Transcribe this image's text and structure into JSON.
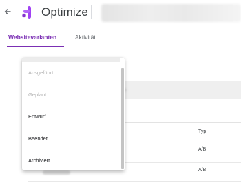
{
  "header": {
    "back_icon": "arrow-left-icon",
    "logo_icon": "optimize-logo-icon",
    "app_title": "Optimize",
    "accent_color": "#7b2fb4"
  },
  "tabs": [
    {
      "label": "Websitevarianten",
      "active": true
    },
    {
      "label": "Aktivität",
      "active": false
    }
  ],
  "table": {
    "columns": [
      "Typ"
    ],
    "rows": [
      {
        "type": "A/B"
      },
      {
        "type": "A/B"
      }
    ]
  },
  "status_menu": {
    "items": [
      {
        "label": "Ausgeführt",
        "enabled": false
      },
      {
        "label": "Geplant",
        "enabled": false
      },
      {
        "label": "Entwurf",
        "enabled": true
      },
      {
        "label": "Beendet",
        "enabled": true
      },
      {
        "label": "Archiviert",
        "enabled": true
      }
    ]
  }
}
